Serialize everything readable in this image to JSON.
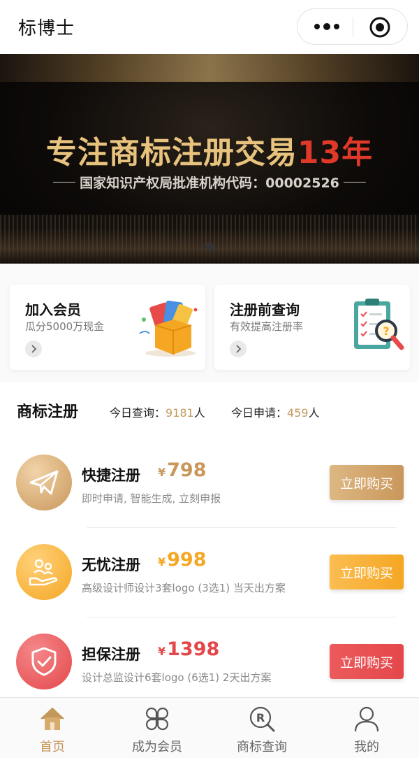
{
  "navbar": {
    "title": "标博士",
    "more_icon": "more-dots-icon",
    "close_icon": "target-circle-icon"
  },
  "banner": {
    "headline_main": "专注商标注册交易",
    "headline_highlight": "13年",
    "subline": "国家知识产权局批准机构代码：00002526",
    "indicator_count": 1
  },
  "cards": [
    {
      "title": "加入会员",
      "subtitle": "瓜分5000万现金",
      "icon": "red-envelope-gift-icon"
    },
    {
      "title": "注册前查询",
      "subtitle": "有效提高注册率",
      "icon": "clipboard-search-icon"
    }
  ],
  "stats": {
    "title": "商标注册",
    "query_label": "今日查询：",
    "query_value": "9181",
    "query_unit": "人",
    "apply_label": "今日申请：",
    "apply_value": "459",
    "apply_unit": "人"
  },
  "products": [
    {
      "name": "快捷注册",
      "currency": "¥",
      "price": "798",
      "desc": "即时申请, 智能生成, 立刻申报",
      "button": "立即购买",
      "icon": "paper-plane-icon",
      "color": "#c9975a"
    },
    {
      "name": "无忧注册",
      "currency": "¥",
      "price": "998",
      "desc": "高级设计师设计3套logo (3选1) 当天出方案",
      "button": "立即购买",
      "icon": "hand-people-icon",
      "color": "#f5a623"
    },
    {
      "name": "担保注册",
      "currency": "¥",
      "price": "1398",
      "desc": "设计总监设计6套logo (6选1) 2天出方案",
      "button": "立即购买",
      "icon": "shield-check-icon",
      "color": "#e4474a"
    }
  ],
  "tabs": [
    {
      "label": "首页",
      "icon": "home-icon",
      "active": true
    },
    {
      "label": "成为会员",
      "icon": "clover-grid-icon",
      "active": false
    },
    {
      "label": "商标查询",
      "icon": "registered-search-icon",
      "active": false
    },
    {
      "label": "我的",
      "icon": "person-icon",
      "active": false
    }
  ],
  "colors": {
    "accent_gold": "#c4975a",
    "price_gold": "#c9975a",
    "price_orange": "#f5a623",
    "price_red": "#e4474a"
  }
}
